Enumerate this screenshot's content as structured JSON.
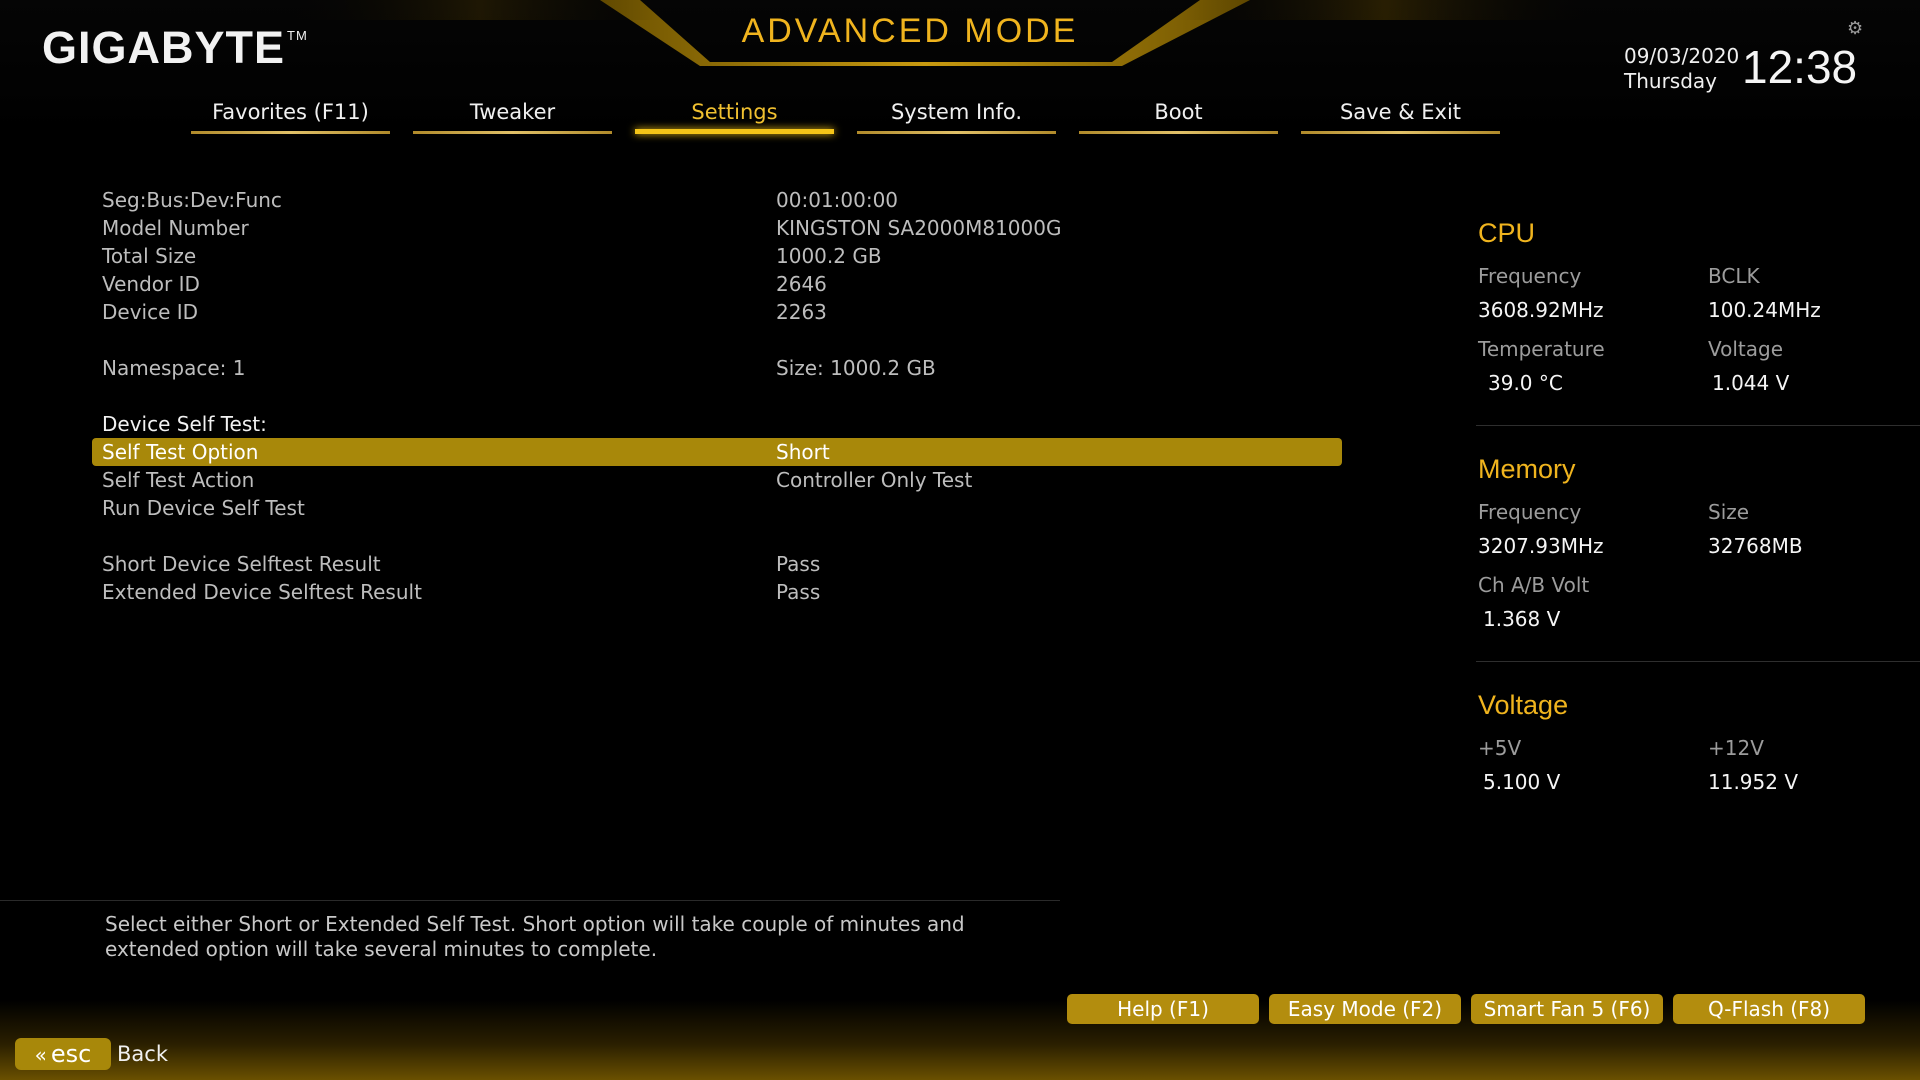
{
  "header": {
    "logo": "GIGABYTE",
    "logo_tm": "TM",
    "mode_title": "ADVANCED MODE",
    "date": "09/03/2020",
    "weekday": "Thursday",
    "time": "12:38"
  },
  "tabs": [
    {
      "label": "Favorites (F11)",
      "active": false
    },
    {
      "label": "Tweaker",
      "active": false
    },
    {
      "label": "Settings",
      "active": true
    },
    {
      "label": "System Info.",
      "active": false
    },
    {
      "label": "Boot",
      "active": false
    },
    {
      "label": "Save & Exit",
      "active": false
    }
  ],
  "main": {
    "rows": [
      {
        "label": "Seg:Bus:Dev:Func",
        "value": "00:01:00:00"
      },
      {
        "label": "Model Number",
        "value": "KINGSTON SA2000M81000G"
      },
      {
        "label": "Total Size",
        "value": "1000.2 GB"
      },
      {
        "label": "Vendor ID",
        "value": "2646"
      },
      {
        "label": "Device ID",
        "value": "2263"
      },
      {
        "label": "Namespace: 1",
        "value": "Size: 1000.2 GB"
      },
      {
        "label": "Device Self Test:",
        "value": ""
      },
      {
        "label": "Self Test Option",
        "value": "Short"
      },
      {
        "label": "Self Test Action",
        "value": "Controller Only Test"
      },
      {
        "label": "Run Device Self Test",
        "value": ""
      },
      {
        "label": "Short Device Selftest Result",
        "value": "Pass"
      },
      {
        "label": "Extended Device Selftest Result",
        "value": "Pass"
      }
    ]
  },
  "monitor": {
    "cpu": {
      "title": "CPU",
      "freq_label": "Frequency",
      "freq_value": "3608.92MHz",
      "bclk_label": "BCLK",
      "bclk_value": "100.24MHz",
      "temp_label": "Temperature",
      "temp_value": "39.0 °C",
      "volt_label": "Voltage",
      "volt_value": "1.044 V"
    },
    "memory": {
      "title": "Memory",
      "freq_label": "Frequency",
      "freq_value": "3207.93MHz",
      "size_label": "Size",
      "size_value": "32768MB",
      "volt_label": "Ch A/B Volt",
      "volt_value": "1.368 V"
    },
    "voltage": {
      "title": "Voltage",
      "v5_label": "+5V",
      "v5_value": "5.100 V",
      "v12_label": "+12V",
      "v12_value": "11.952 V"
    }
  },
  "help_text": "Select either Short or Extended Self Test. Short option will take couple of minutes and extended option will take several minutes to complete.",
  "footer": {
    "fkeys": [
      "Help (F1)",
      "Easy Mode (F2)",
      "Smart Fan 5 (F6)",
      "Q-Flash (F8)"
    ],
    "esc_label": "esc",
    "back_label": "Back"
  },
  "colors": {
    "accent": "#f0b41e",
    "selection": "#a8880a"
  }
}
